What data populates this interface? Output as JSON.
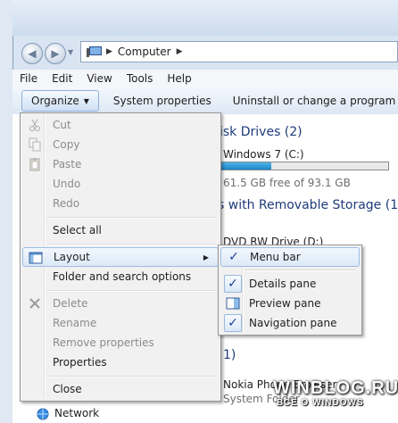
{
  "address": {
    "crumbs": [
      "Computer"
    ]
  },
  "menubar": [
    "File",
    "Edit",
    "View",
    "Tools",
    "Help"
  ],
  "toolbar": {
    "organize": "Organize",
    "system_properties": "System properties",
    "uninstall": "Uninstall or change a program"
  },
  "content": {
    "group_hdd": "isk Drives (2)",
    "drive_c_name": "Windows 7 (C:)",
    "drive_c_space": "61.5 GB free of 93.1 GB",
    "drive_c_used_fraction": 0.34,
    "group_removable": "s with Removable Storage (1)",
    "dvd_name": "DVD RW Drive (D:)",
    "other_group": "1)",
    "nokia_name": "Nokia Phone Browser",
    "nokia_type": "System Folder",
    "network": "Network"
  },
  "organize_menu": {
    "cut": "Cut",
    "copy": "Copy",
    "paste": "Paste",
    "undo": "Undo",
    "redo": "Redo",
    "select_all": "Select all",
    "layout": "Layout",
    "folder_options": "Folder and search options",
    "delete": "Delete",
    "rename": "Rename",
    "remove_properties": "Remove properties",
    "properties": "Properties",
    "close": "Close"
  },
  "layout_submenu": {
    "menu_bar": "Menu bar",
    "details_pane": "Details pane",
    "preview_pane": "Preview pane",
    "navigation_pane": "Navigation pane"
  },
  "watermark": {
    "line1": "WINBLOG.RU",
    "line2": "ВСЁ О WINDOWS"
  },
  "colors": {
    "accent": "#1c3f95",
    "highlight_border": "#9dbde3"
  }
}
